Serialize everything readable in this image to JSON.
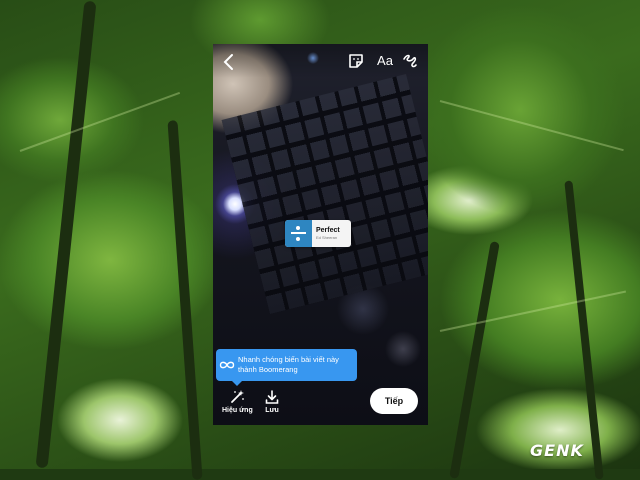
{
  "story_editor": {
    "top_bar": {
      "back_icon": "chevron-left-icon",
      "sticker_icon": "sticker-icon",
      "text_tool_label": "Aa",
      "draw_icon": "squiggle-draw-icon"
    },
    "music_sticker": {
      "title": "Perfect",
      "artist": "Ed Sheeran"
    },
    "tooltip": {
      "icon": "infinity-icon",
      "text": "Nhanh chóng biến bài viết này thành Boomerang",
      "color": "#3897f0"
    },
    "bottom_bar": {
      "effects_label": "Hiệu ứng",
      "save_label": "Lưu",
      "next_label": "Tiếp"
    }
  },
  "watermark": {
    "text": "GENK",
    "accent": "#e53935"
  }
}
